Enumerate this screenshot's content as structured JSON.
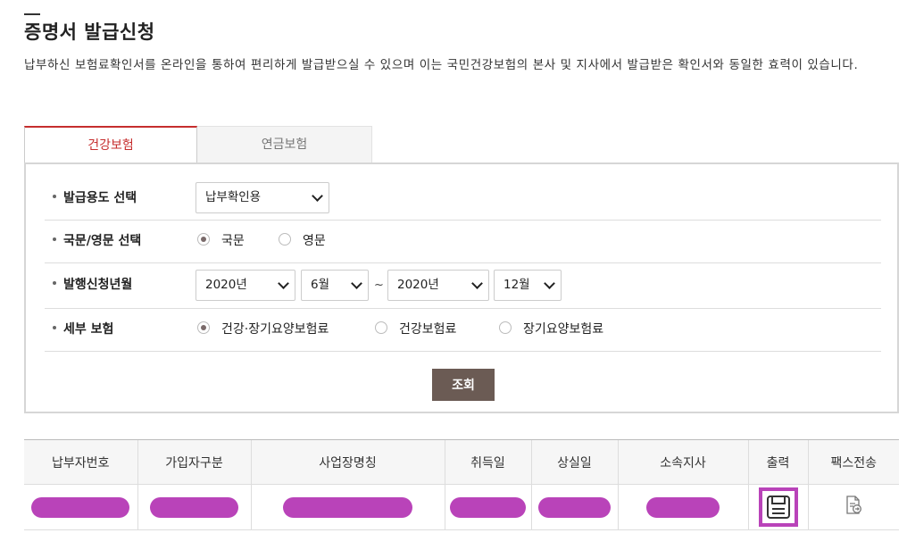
{
  "page": {
    "title": "증명서 발급신청",
    "intro": "납부하신 보험료확인서를 온라인을 통하여 편리하게 발급받으실 수 있으며 이는 국민건강보험의 본사 및 지사에서 발급받은 확인서와 동일한 효력이 있습니다."
  },
  "tabs": [
    {
      "label": "건강보험",
      "active": true
    },
    {
      "label": "연금보험",
      "active": false
    }
  ],
  "form": {
    "purpose": {
      "label": "발급용도 선택",
      "value": "납부확인용"
    },
    "language": {
      "label": "국문/영문 선택",
      "options": [
        {
          "label": "국문",
          "checked": true
        },
        {
          "label": "영문",
          "checked": false
        }
      ]
    },
    "period": {
      "label": "발행신청년월",
      "from_year": "2020년",
      "from_month": "6월",
      "separator": "~",
      "to_year": "2020년",
      "to_month": "12월"
    },
    "detail": {
      "label": "세부 보험",
      "options": [
        {
          "label": "건강·장기요양보험료",
          "checked": true
        },
        {
          "label": "건강보험료",
          "checked": false
        },
        {
          "label": "장기요양보험료",
          "checked": false
        }
      ]
    },
    "query_button": "조회"
  },
  "table": {
    "headers": [
      "납부자번호",
      "가입자구분",
      "사업장명칭",
      "취득일",
      "상실일",
      "소속지사",
      "출력",
      "팩스전송"
    ],
    "rows": [
      {
        "redacted": true
      }
    ]
  },
  "colors": {
    "accent_red": "#c62e2e",
    "button_brown": "#6b5b54",
    "redaction_purple": "#b943b9"
  },
  "icons": {
    "print": "print-icon",
    "fax": "fax-document-icon"
  }
}
